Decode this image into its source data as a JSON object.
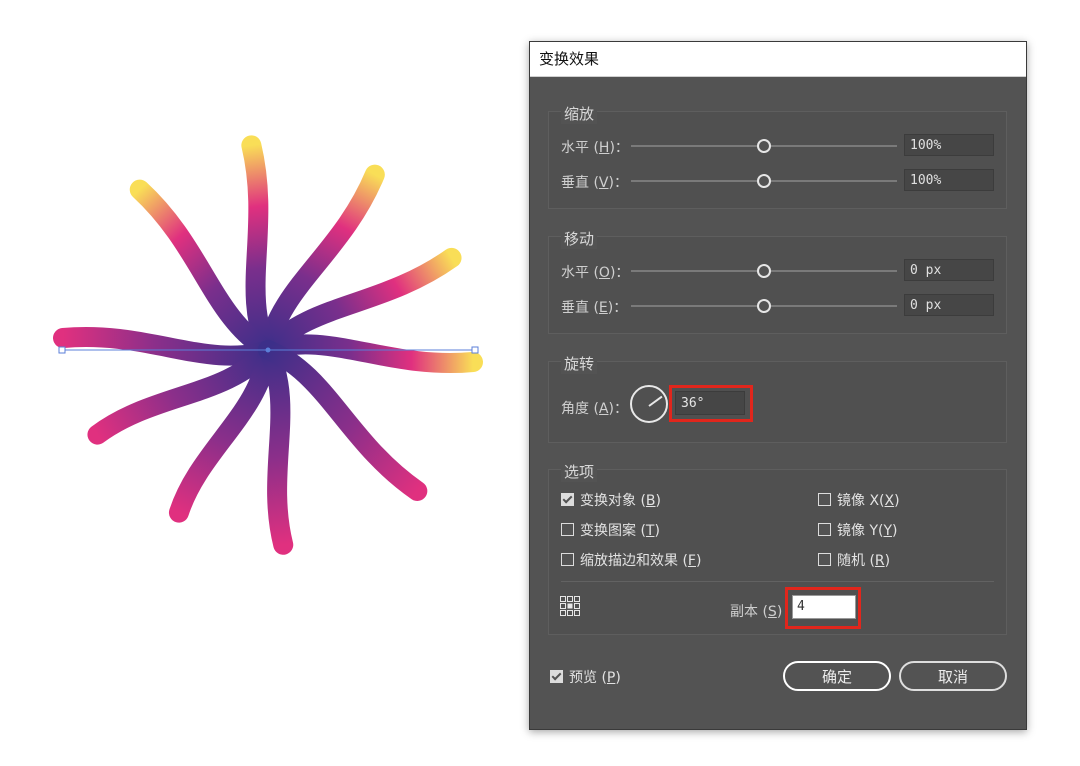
{
  "dialog": {
    "title": "变换效果",
    "scale": {
      "title": "缩放",
      "horizontal": {
        "label": "水平 (",
        "key": "H",
        "suffix": ")：",
        "value": "100%",
        "slider_pct": 50
      },
      "vertical": {
        "label": "垂直 (",
        "key": "V",
        "suffix": ")：",
        "value": "100%",
        "slider_pct": 50
      }
    },
    "move": {
      "title": "移动",
      "horizontal": {
        "label": "水平 (",
        "key": "O",
        "suffix": ")：",
        "value": "0 px",
        "slider_pct": 50
      },
      "vertical": {
        "label": "垂直 (",
        "key": "E",
        "suffix": ")：",
        "value": "0 px",
        "slider_pct": 50
      }
    },
    "rotate": {
      "title": "旋转",
      "angle": {
        "label": "角度 (",
        "key": "A",
        "suffix": ")：",
        "value": "36°"
      }
    },
    "options": {
      "title": "选项",
      "transform_objects": {
        "label": "变换对象 (",
        "key": "B",
        "suffix": ")",
        "checked": true
      },
      "transform_patterns": {
        "label": "变换图案 (",
        "key": "T",
        "suffix": ")",
        "checked": false
      },
      "scale_strokes": {
        "label": "缩放描边和效果 (",
        "key": "F",
        "suffix": ")",
        "checked": false
      },
      "reflect_x": {
        "label": "镜像 X(",
        "key": "X",
        "suffix": ")",
        "checked": false
      },
      "reflect_y": {
        "label": "镜像 Y(",
        "key": "Y",
        "suffix": ")",
        "checked": false
      },
      "random": {
        "label": "随机 (",
        "key": "R",
        "suffix": ")",
        "checked": false
      },
      "copies": {
        "label": "副本 (",
        "key": "S",
        "suffix": ")",
        "value": "4"
      }
    },
    "preview": {
      "label": "预览 (",
      "key": "P",
      "suffix": ")",
      "checked": true
    },
    "ok_label": "确定",
    "cancel_label": "取消"
  },
  "colors": {
    "dialog_bg": "#535353",
    "highlight": "#e1261c",
    "gradient": [
      "#f9de57",
      "#ee6d72",
      "#e0307f",
      "#5a2f8e",
      "#3c2f89"
    ]
  }
}
